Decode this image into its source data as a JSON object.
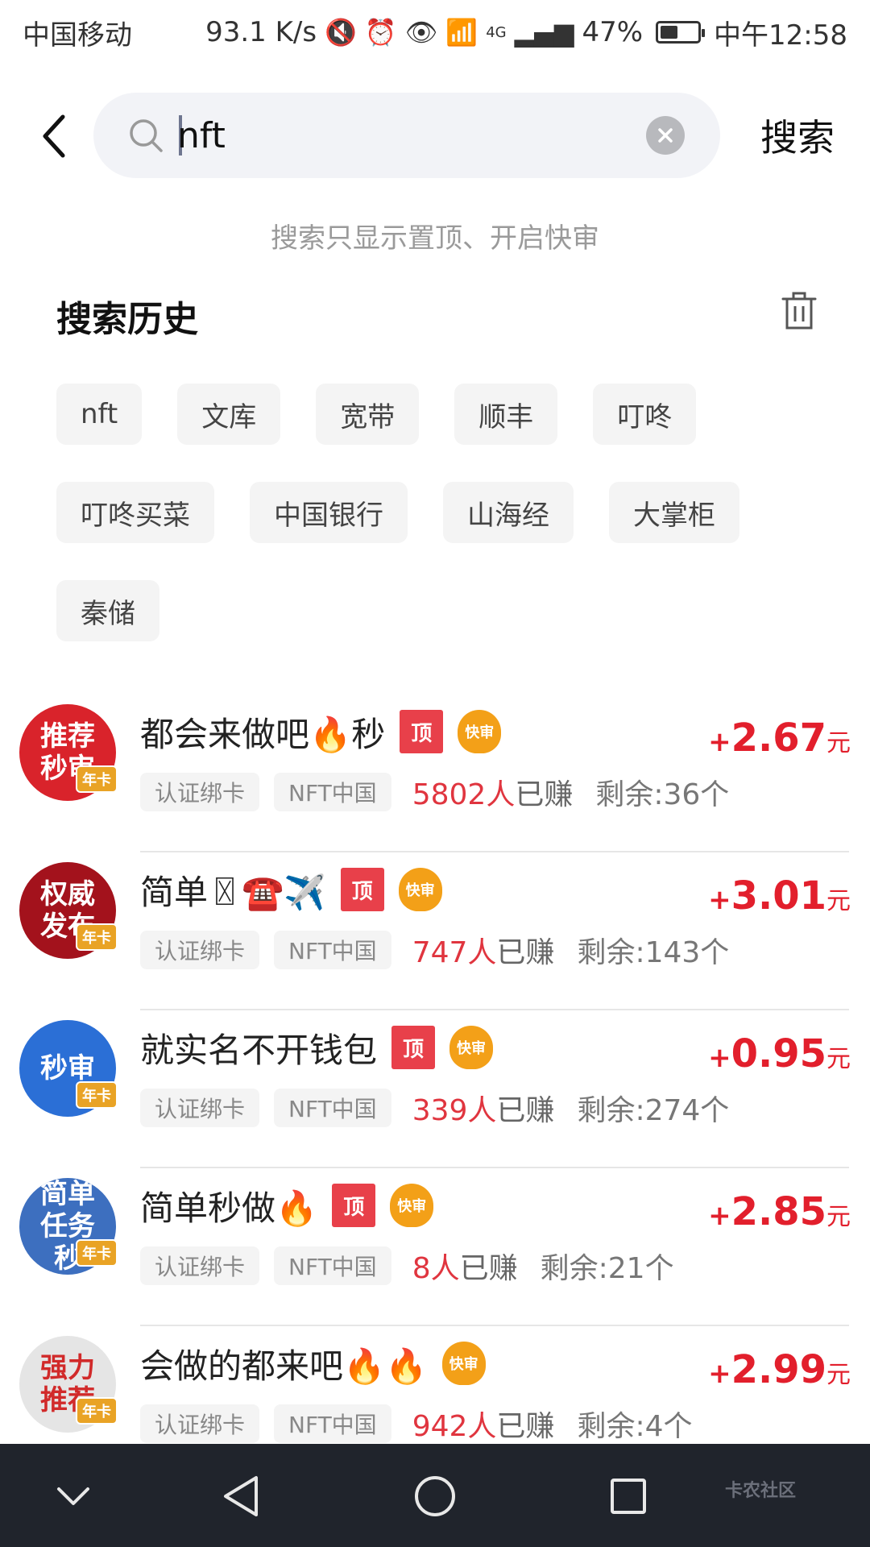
{
  "status_bar": {
    "carrier": "中国移动",
    "net_speed": "93.1 K/s",
    "net_type": "4G",
    "battery": "47%",
    "battery_level": 0.47,
    "time": "中午12:58"
  },
  "search": {
    "query": "nft",
    "button_label": "搜索",
    "tip": "搜索只显示置顶、开启快审"
  },
  "history": {
    "title": "搜索历史",
    "tags": [
      "nft",
      "文库",
      "宽带",
      "顺丰",
      "叮咚",
      "叮咚买菜",
      "中国银行",
      "山海经",
      "大掌柜",
      "秦储"
    ]
  },
  "badges": {
    "top": "顶",
    "fast": "快审",
    "crown": "年卡",
    "earned_suffix": "人已赚",
    "remain_prefix": "剩余:",
    "remain_suffix": "个",
    "price_plus": "+",
    "price_unit": "元"
  },
  "tasks": [
    {
      "avatar_text": "推荐秒审",
      "avatar_color": "#d9232b",
      "title": "都会来做吧🔥秒",
      "has_top": true,
      "chips": [
        "认证绑卡",
        "NFT中国"
      ],
      "earned": "5802",
      "remain": "36",
      "price": "2.67"
    },
    {
      "avatar_text": "权威发布",
      "avatar_color": "#a3121c",
      "title": "简单〿☎️✈️",
      "has_top": true,
      "chips": [
        "认证绑卡",
        "NFT中国"
      ],
      "earned": "747",
      "remain": "143",
      "price": "3.01"
    },
    {
      "avatar_text": "秒审",
      "avatar_color": "#2b6fd6",
      "title": "就实名不开钱包",
      "has_top": true,
      "chips": [
        "认证绑卡",
        "NFT中国"
      ],
      "earned": "339",
      "remain": "274",
      "price": "0.95"
    },
    {
      "avatar_text": "简单任务秒",
      "avatar_color": "#3d6fbf",
      "title": "简单秒做🔥",
      "has_top": true,
      "chips": [
        "认证绑卡",
        "NFT中国"
      ],
      "earned": "8",
      "remain": "21",
      "price": "2.85"
    },
    {
      "avatar_text": "强力推荐",
      "avatar_color": "#e5e5e5",
      "title": "会做的都来吧🔥🔥",
      "has_top": false,
      "chips": [
        "认证绑卡",
        "NFT中国"
      ],
      "earned": "942",
      "remain": "4",
      "price": "2.99"
    }
  ],
  "nav": {
    "watermark": "卡农社区"
  }
}
